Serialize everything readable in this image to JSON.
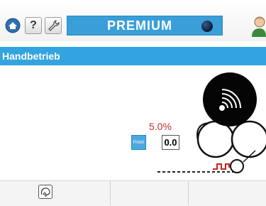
{
  "toolbar": {
    "home_icon": "home-icon",
    "help_label": "?",
    "tool_icon": "wrench-icon",
    "premium_label": "PREMIUM",
    "premium_status_icon": "status-ball-icon",
    "user_icon": "user-icon"
  },
  "titlebar": {
    "title": "Handbetrieb"
  },
  "main": {
    "percentage": "5.0%",
    "finish_label": "Finish",
    "value": "0.0"
  },
  "bottombar": {
    "first_icon": "operator-icon"
  },
  "colors": {
    "accent_blue": "#34a4e0",
    "percentage_red": "#c0302a",
    "signal_red": "#d0201a"
  }
}
